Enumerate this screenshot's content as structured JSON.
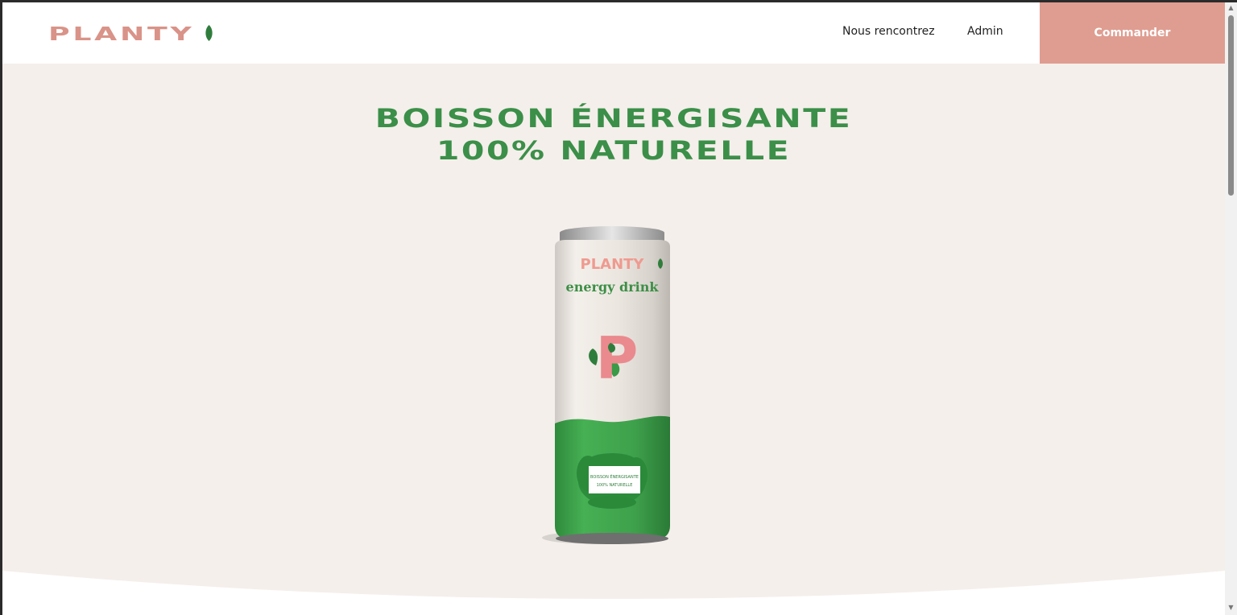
{
  "header": {
    "logo": "PLANTY",
    "nav": [
      {
        "label": "Nous rencontrez"
      },
      {
        "label": "Admin"
      }
    ],
    "cta_label": "Commander"
  },
  "hero": {
    "title_line1": "BOISSON ÉNERGISANTE",
    "title_line2": "100% NATURELLE"
  },
  "product": {
    "brand": "PLANTY",
    "subtitle": "energy drink",
    "letter": "P",
    "label_line1": "BOISSON ÉNERGISANTE",
    "label_line2": "100% NATURELLE"
  },
  "colors": {
    "brand_pink": "#df9d91",
    "brand_green": "#3b8f48",
    "background": "#f4efeb"
  },
  "icons": {
    "logo_leaf": "leaf-icon"
  }
}
